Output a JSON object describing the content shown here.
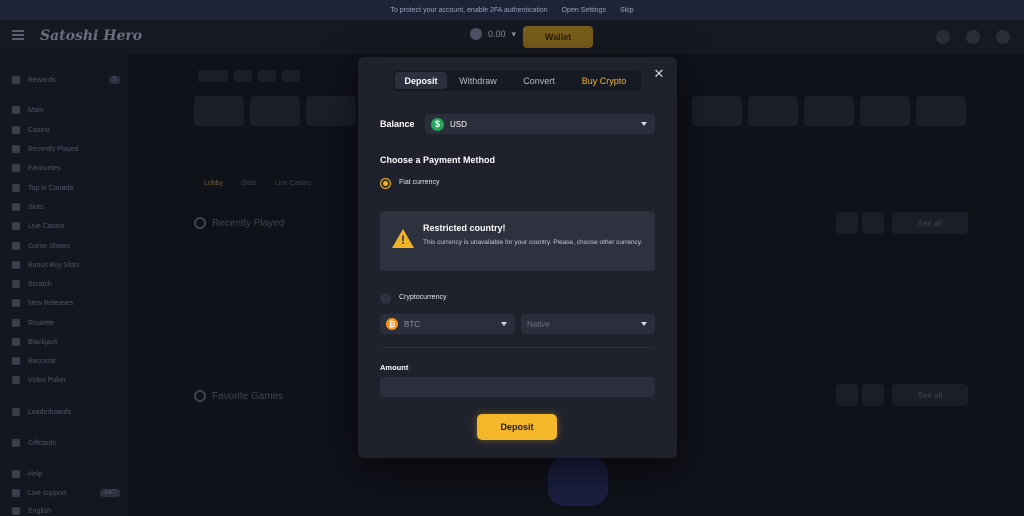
{
  "background": {
    "banner": {
      "text": "To protect your account, enable 2FA authentication",
      "link": "Open Settings",
      "skip": "Skip"
    },
    "logo": "Satoshi Hero",
    "balance": "0.00",
    "wallet_label": "Wallet",
    "sidebar": [
      {
        "label": "Rewards",
        "badge": "0"
      },
      {
        "label": "Main"
      },
      {
        "label": "Casino"
      },
      {
        "label": "Recently Played"
      },
      {
        "label": "Favourites"
      },
      {
        "label": "Top in Canada"
      },
      {
        "label": "Slots"
      },
      {
        "label": "Live Casino"
      },
      {
        "label": "Game Shows"
      },
      {
        "label": "Bonus Buy Slots"
      },
      {
        "label": "Scratch"
      },
      {
        "label": "New Releases"
      },
      {
        "label": "Roulette"
      },
      {
        "label": "Blackjack"
      },
      {
        "label": "Baccarat"
      },
      {
        "label": "Video Poker"
      },
      {
        "label": "Leaderboards"
      },
      {
        "label": "Giftcards"
      },
      {
        "label": "Help"
      },
      {
        "label": "Live support",
        "badge": "24/7"
      },
      {
        "label": "English"
      }
    ],
    "lobby_tabs": [
      "Lobby",
      "Slots",
      "Live Casino"
    ],
    "recently_played": "Recently Played",
    "favorite_games": "Favorite Games",
    "see_all": "See all"
  },
  "modal": {
    "tabs": [
      {
        "label": "Deposit",
        "active": true
      },
      {
        "label": "Withdraw",
        "active": false
      },
      {
        "label": "Convert",
        "active": false
      },
      {
        "label": "Buy Crypto",
        "active": false
      }
    ],
    "close_icon": "close-icon",
    "balance_label": "Balance",
    "balance_currency": "USD",
    "payment_method_title": "Choose a Payment Method",
    "fiat_label": "Fiat currency",
    "fiat_selected": true,
    "alert": {
      "title": "Restricted country!",
      "text": "This currency is unavailable for your country. Please, choose other currency.",
      "icon": "warning-icon"
    },
    "crypto_label": "Cryptocurrency",
    "crypto_selected": false,
    "crypto_coin": "BTC",
    "crypto_network": "Native",
    "amount_label": "Amount",
    "amount_value": "",
    "deposit_button": "Deposit"
  },
  "colors": {
    "accent": "#f5b72a",
    "modal_bg": "#1f222d",
    "field_bg": "#2b2f3b",
    "usd_green": "#23a55a",
    "btc_orange": "#f7931a"
  }
}
